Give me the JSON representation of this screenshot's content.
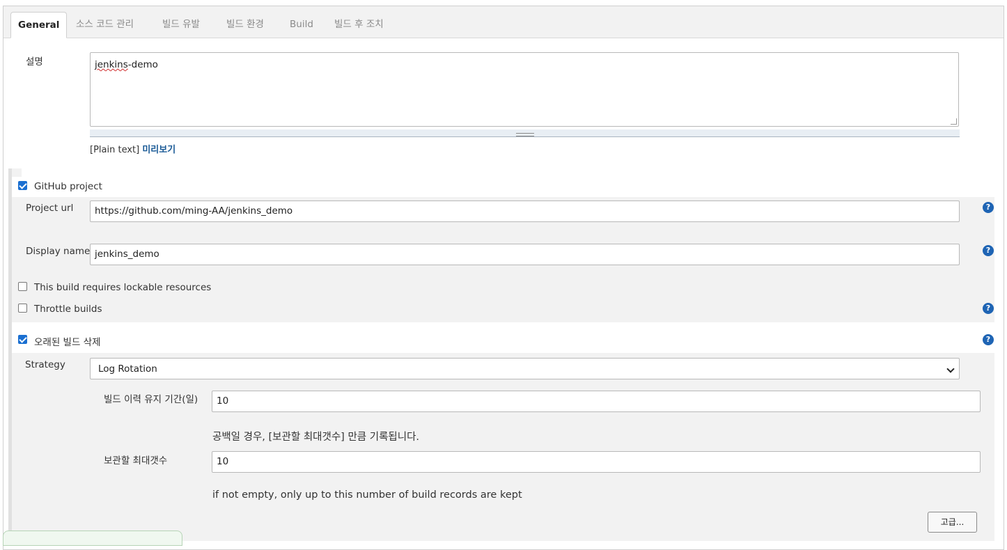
{
  "tabs": [
    "General",
    "소스 코드 관리",
    "빌드 유발",
    "빌드 환경",
    "Build",
    "빌드 후 조치"
  ],
  "description": {
    "label": "설명",
    "value_prefix": "jenkins",
    "value_suffix": "-demo",
    "format_text": "[Plain text]",
    "preview_link": "미리보기"
  },
  "github_project": {
    "checkbox_label": "GitHub project",
    "checked": true,
    "project_url_label": "Project url",
    "project_url_value": "https://github.com/ming-AA/jenkins_demo",
    "display_name_label": "Display name",
    "display_name_value": "jenkins_demo"
  },
  "lockable": {
    "label": "This build requires lockable resources",
    "checked": false
  },
  "throttle": {
    "label": "Throttle builds",
    "checked": false
  },
  "discard_old": {
    "label": "오래된 빌드 삭제",
    "checked": true,
    "strategy_label": "Strategy",
    "strategy_value": "Log Rotation",
    "days_label": "빌드 이력 유지 기간(일)",
    "days_value": "10",
    "days_hint": "공백일 경우, [보관할 최대갯수] 만큼 기록됩니다.",
    "max_label": "보관할 최대갯수",
    "max_value": "10",
    "max_hint": "if not empty, only up to this number of build records are kept",
    "advanced_button": "고급..."
  },
  "icons": {
    "help": "?",
    "help_name": "help-icon",
    "checkmark": "checkbox-check-icon"
  },
  "colors": {
    "help_blue": "#1e64b4",
    "checkbox_blue": "#1a6fd1",
    "link_blue": "#1a5a96",
    "section_bg": "#f2f2f2"
  }
}
